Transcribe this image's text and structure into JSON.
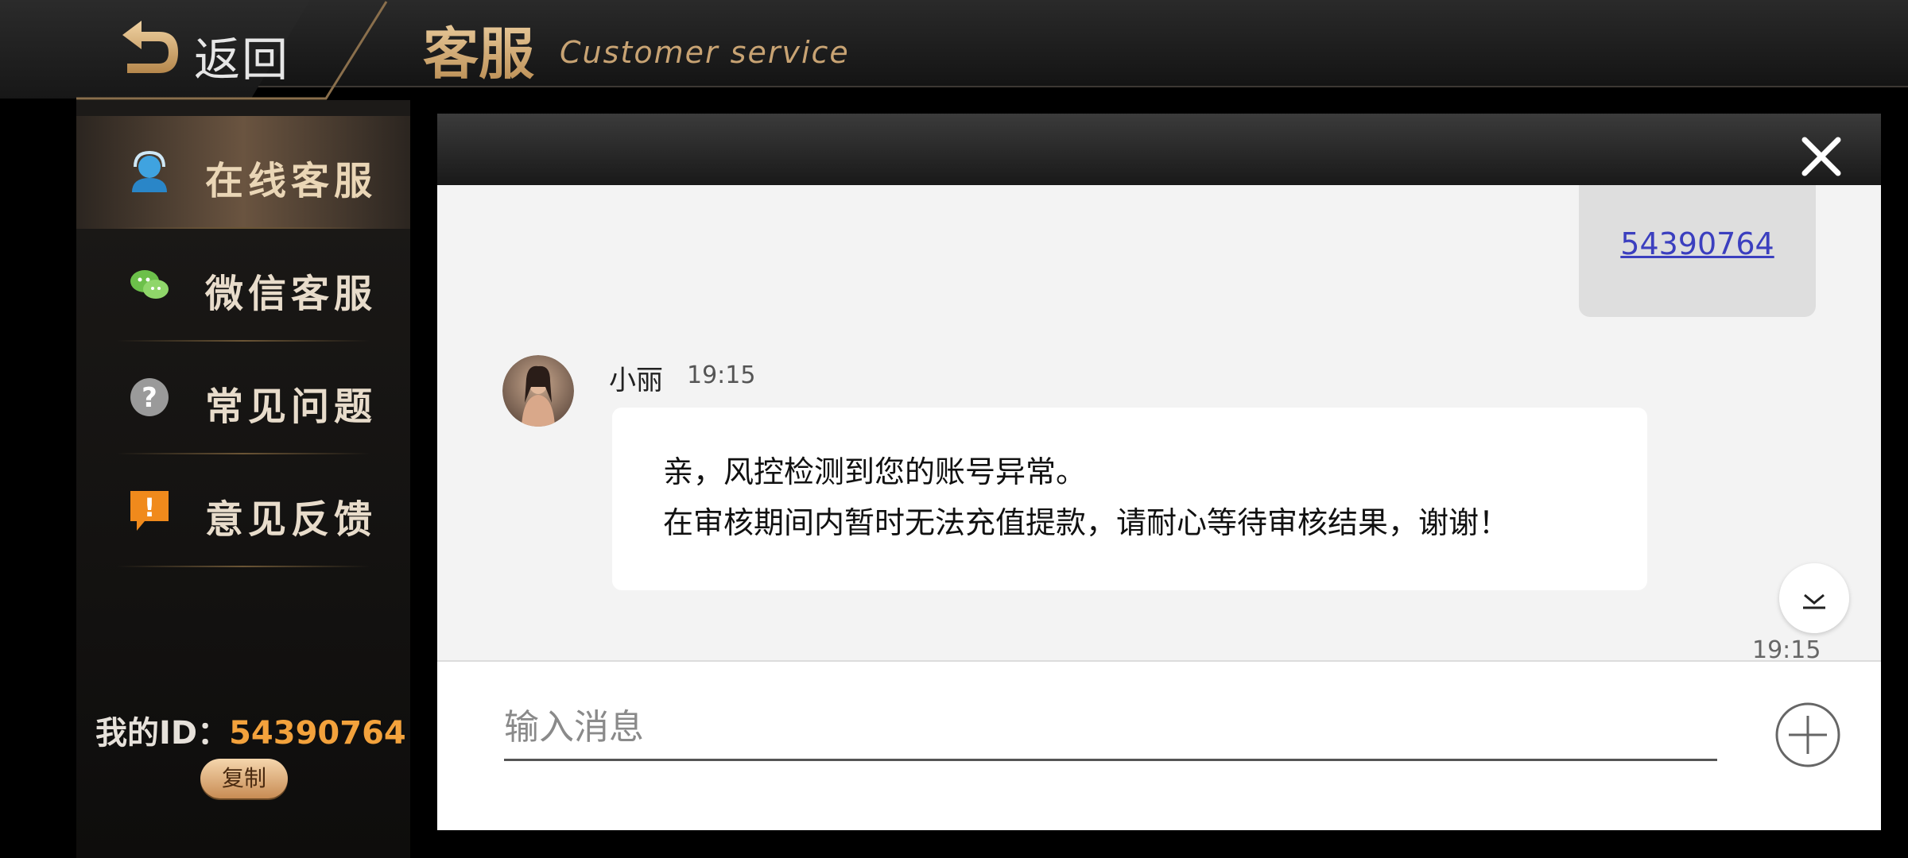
{
  "header": {
    "back_label": "返回",
    "title_cn": "客服",
    "title_en": "Customer service"
  },
  "sidebar": {
    "items": [
      {
        "label": "在线客服",
        "icon": "headset-user-icon",
        "active": true
      },
      {
        "label": "微信客服",
        "icon": "wechat-icon",
        "active": false
      },
      {
        "label": "常见问题",
        "icon": "question-icon",
        "active": false
      },
      {
        "label": "意见反馈",
        "icon": "exclamation-bubble-icon",
        "active": false
      }
    ],
    "my_id_label": "我的ID：",
    "my_id_value": "54390764",
    "copy_label": "复制"
  },
  "chat": {
    "sent_message": "54390764",
    "sender_name": "小丽",
    "sender_time": "19:15",
    "received_lines": [
      "亲，风控检测到您的账号异常。",
      "在审核期间内暂时无法充值提款，请耐心等待审核结果，谢谢！"
    ],
    "bottom_time": "19:15",
    "input_placeholder": "输入消息"
  },
  "colors": {
    "accent_gold": "#d9b07a",
    "id_orange": "#f3a23c",
    "link_blue": "#3b3fbf"
  }
}
